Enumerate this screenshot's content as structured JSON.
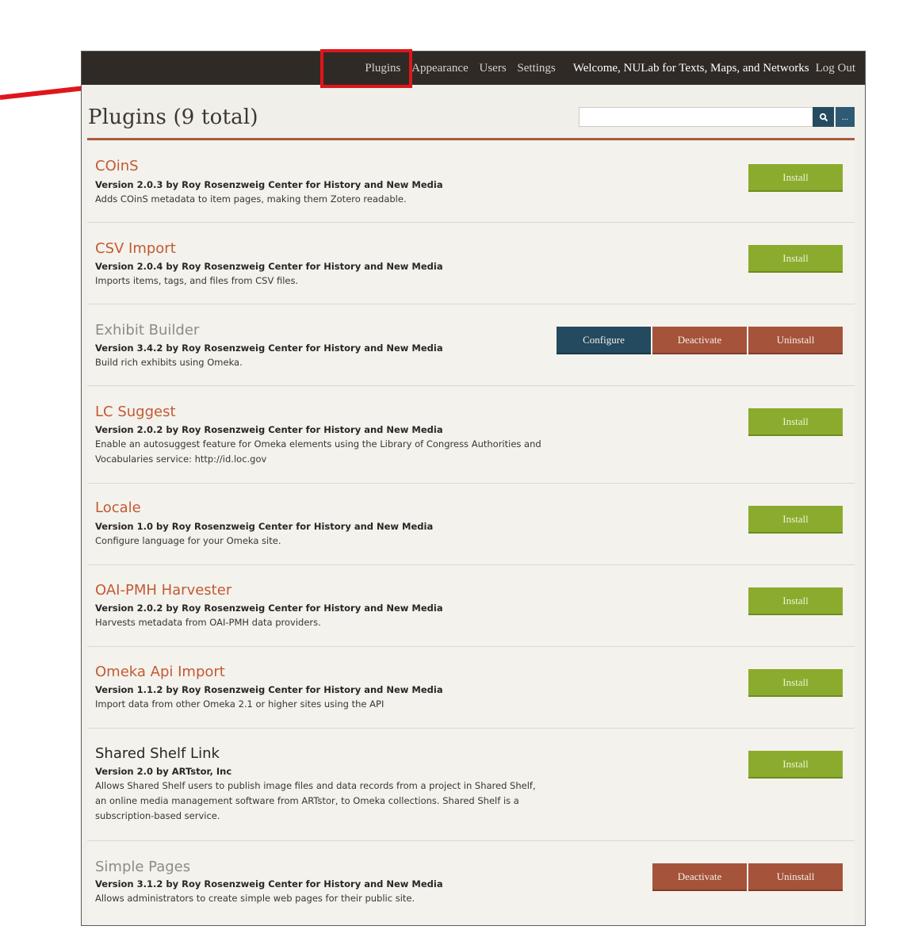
{
  "topbar": {
    "nav": [
      "Plugins",
      "Appearance",
      "Users",
      "Settings"
    ],
    "welcome": "Welcome, NULab for Texts, Maps, and Networks",
    "logout": "Log Out"
  },
  "page_title": "Plugins (9 total)",
  "search": {
    "placeholder": "",
    "advanced_label": "..."
  },
  "colors": {
    "accent": "#c25a34",
    "install": "#8bab2e",
    "configure": "#234a5f",
    "deactivate": "#a5533a",
    "annotation": "#e0161b"
  },
  "plugins": [
    {
      "name": "COinS",
      "version": "Version 2.0.3 by Roy Rosenzweig Center for History and New Media",
      "description": "Adds COinS metadata to item pages, making them Zotero readable.",
      "buttons": [
        "Install"
      ]
    },
    {
      "name": "CSV Import",
      "version": "Version 2.0.4 by Roy Rosenzweig Center for History and New Media",
      "description": "Imports items, tags, and files from CSV files.",
      "buttons": [
        "Install"
      ]
    },
    {
      "name": "Exhibit Builder",
      "version": "Version 3.4.2 by Roy Rosenzweig Center for History and New Media",
      "description": "Build rich exhibits using Omeka.",
      "buttons": [
        "Configure",
        "Deactivate",
        "Uninstall"
      ]
    },
    {
      "name": "LC Suggest",
      "version": "Version 2.0.2 by Roy Rosenzweig Center for History and New Media",
      "description": "Enable an autosuggest feature for Omeka elements using the Library of Congress Authorities and Vocabularies service: http://id.loc.gov",
      "buttons": [
        "Install"
      ]
    },
    {
      "name": "Locale",
      "version": "Version 1.0 by Roy Rosenzweig Center for History and New Media",
      "description": "Configure language for your Omeka site.",
      "buttons": [
        "Install"
      ]
    },
    {
      "name": "OAI-PMH Harvester",
      "version": "Version 2.0.2 by Roy Rosenzweig Center for History and New Media",
      "description": "Harvests metadata from OAI-PMH data providers.",
      "buttons": [
        "Install"
      ]
    },
    {
      "name": "Omeka Api Import",
      "version": "Version 1.1.2 by Roy Rosenzweig Center for History and New Media",
      "description": "Import data from other Omeka 2.1 or higher sites using the API",
      "buttons": [
        "Install"
      ]
    },
    {
      "name": "Shared Shelf Link",
      "version": "Version 2.0 by ARTstor, Inc",
      "description": "Allows Shared Shelf users to publish image files and data records from a project in Shared Shelf, an online media management software from ARTstor, to Omeka collections. Shared Shelf is a subscription-based service.",
      "buttons": [
        "Install"
      ]
    },
    {
      "name": "Simple Pages",
      "version": "Version 3.1.2 by Roy Rosenzweig Center for History and New Media",
      "description": "Allows administrators to create simple web pages for their public site.",
      "buttons": [
        "Deactivate",
        "Uninstall"
      ]
    }
  ]
}
